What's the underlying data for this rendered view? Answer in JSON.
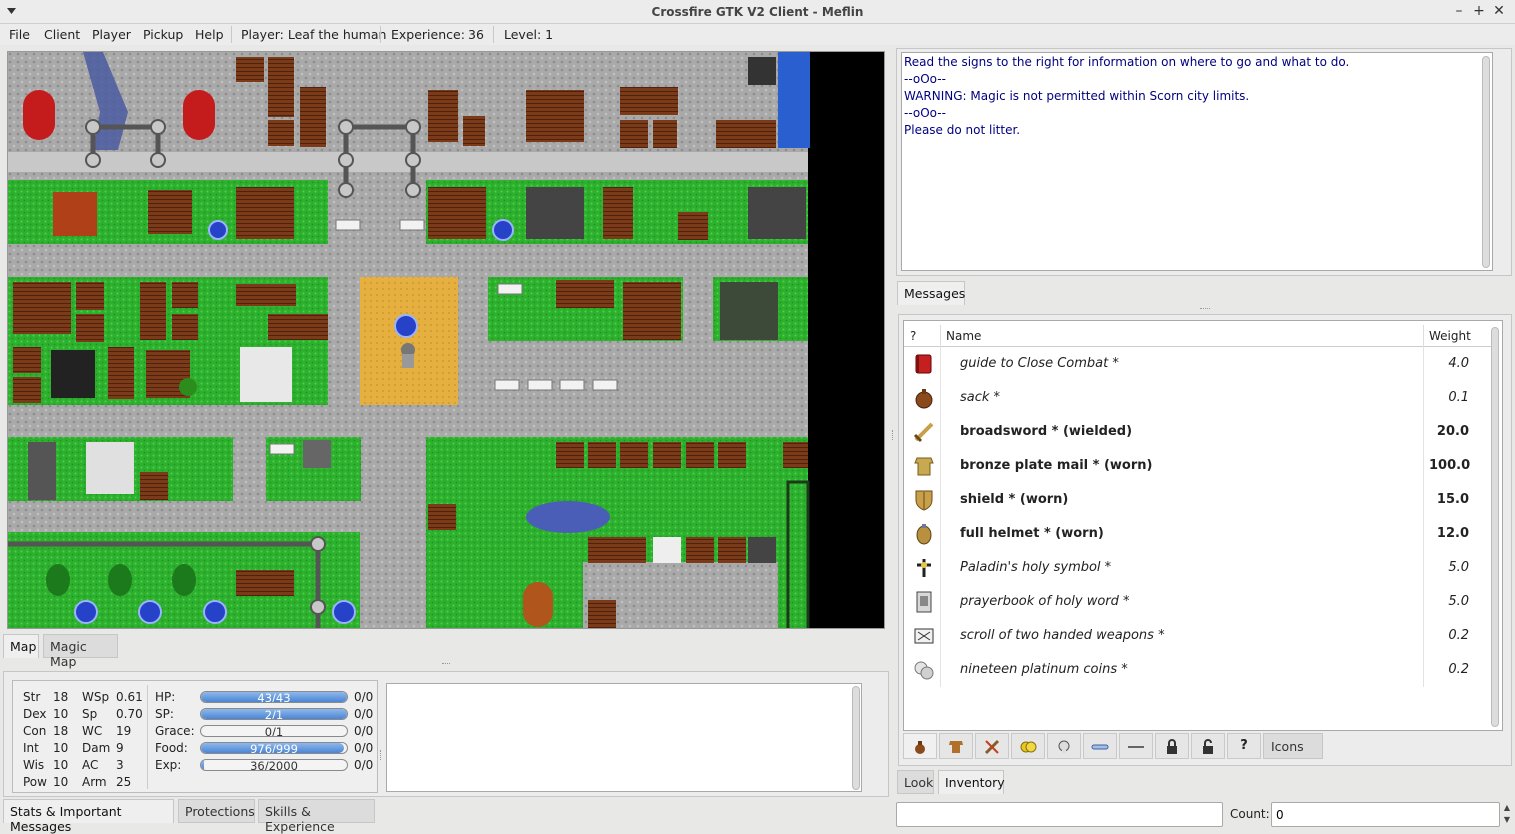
{
  "window": {
    "title": "Crossfire GTK V2 Client - Meflin",
    "min": "–",
    "max": "+",
    "close": "✕"
  },
  "menubar": {
    "items": [
      "File",
      "Client",
      "Player",
      "Pickup",
      "Help"
    ],
    "player": "Player: Leaf the human",
    "experience_label": "Experience:",
    "experience_value": "36",
    "level": "Level: 1"
  },
  "map_tabs": [
    "Map",
    "Magic Map"
  ],
  "messages": {
    "lines": [
      "Read the signs to the right for information on where to go and what to do.",
      "--oOo--",
      "WARNING: Magic is not permitted within Scorn city limits.",
      "--oOo--",
      "Please do not litter."
    ],
    "tab": "Messages"
  },
  "inventory": {
    "headers": {
      "q": "?",
      "name": "Name",
      "weight": "Weight"
    },
    "items": [
      {
        "name": "guide to Close Combat  *",
        "weight": "4.0",
        "bold": false,
        "icon": "book-icon"
      },
      {
        "name": "sack  *",
        "weight": "0.1",
        "bold": false,
        "icon": "sack-icon"
      },
      {
        "name": "broadsword  * (wielded)",
        "weight": "20.0",
        "bold": true,
        "icon": "sword-icon"
      },
      {
        "name": "bronze plate mail  * (worn)",
        "weight": "100.0",
        "bold": true,
        "icon": "armor-icon"
      },
      {
        "name": "shield  * (worn)",
        "weight": "15.0",
        "bold": true,
        "icon": "shield-icon"
      },
      {
        "name": "full helmet  * (worn)",
        "weight": "12.0",
        "bold": true,
        "icon": "helmet-icon"
      },
      {
        "name": "Paladin's holy symbol  *",
        "weight": "5.0",
        "bold": false,
        "icon": "holy-symbol-icon"
      },
      {
        "name": "prayerbook of holy word  *",
        "weight": "5.0",
        "bold": false,
        "icon": "prayerbook-icon"
      },
      {
        "name": "scroll of two handed weapons  *",
        "weight": "0.2",
        "bold": false,
        "icon": "scroll-icon"
      },
      {
        "name": "nineteen platinum coins  *",
        "weight": "0.2",
        "bold": false,
        "icon": "coins-icon"
      }
    ],
    "filters": [
      "bag-icon",
      "armor-filter-icon",
      "weapons-icon",
      "money-icon",
      "skull-icon",
      "wand-icon",
      "key-icon",
      "lock-icon",
      "unlocked-icon",
      "unknown-icon"
    ],
    "filter_question": "?",
    "icons_tab": "Icons",
    "tabs": [
      "Look",
      "Inventory"
    ],
    "count_label": "Count:",
    "count_value": "0"
  },
  "stats": {
    "left": [
      [
        "Str",
        "18"
      ],
      [
        "Dex",
        "10"
      ],
      [
        "Con",
        "18"
      ],
      [
        "Int",
        "10"
      ],
      [
        "Wis",
        "10"
      ],
      [
        "Pow",
        "10"
      ]
    ],
    "mid": [
      [
        "WSp",
        "0.61"
      ],
      [
        "Sp",
        "0.70"
      ],
      [
        "WC",
        "19"
      ],
      [
        "Dam",
        "9"
      ],
      [
        "AC",
        "3"
      ],
      [
        "Arm",
        "25"
      ]
    ],
    "bars": [
      {
        "label": "HP:",
        "text": "43/43",
        "fill": 1.0,
        "extra": "0/0"
      },
      {
        "label": "SP:",
        "text": "2/1",
        "fill": 1.0,
        "extra": "0/0"
      },
      {
        "label": "Grace:",
        "text": "0/1",
        "fill": 0.0,
        "extra": "0/0"
      },
      {
        "label": "Food:",
        "text": "976/999",
        "fill": 0.977,
        "extra": "0/0"
      },
      {
        "label": "Exp:",
        "text": "36/2000",
        "fill": 0.018,
        "extra": "0/0"
      }
    ]
  },
  "bottom_tabs": [
    "Stats & Important Messages",
    "Protections",
    "Skills & Experience"
  ],
  "colors": {
    "grass": "#2fb52f",
    "road": "#a8a8a8",
    "roof": "#7a3a1a",
    "water": "#3a6fd8",
    "bar": "#4a86d4",
    "msg_text": "#000080"
  }
}
